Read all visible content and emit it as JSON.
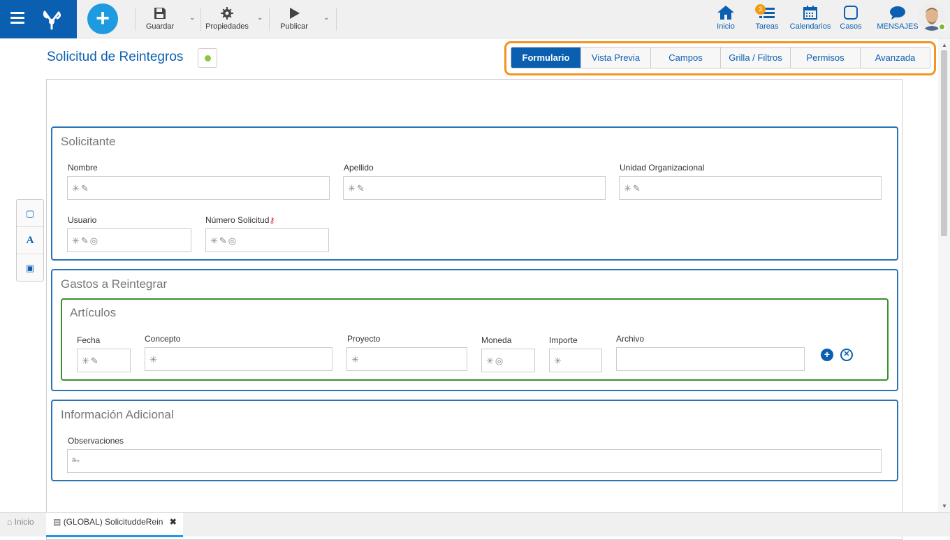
{
  "toolbar": {
    "save_label": "Guardar",
    "properties_label": "Propiedades",
    "publish_label": "Publicar"
  },
  "nav": {
    "home_label": "Inicio",
    "tasks_label": "Tareas",
    "tasks_badge": "3",
    "calendars_label": "Calendarios",
    "cases_label": "Casos",
    "messages_label": "MENSAJES"
  },
  "page": {
    "title": "Solicitud de Reintegros"
  },
  "tabs": [
    {
      "label": "Formulario",
      "active": true
    },
    {
      "label": "Vista Previa"
    },
    {
      "label": "Campos"
    },
    {
      "label": "Grilla / Filtros"
    },
    {
      "label": "Permisos"
    },
    {
      "label": "Avanzada"
    }
  ],
  "sections": {
    "solicitante": {
      "title": "Solicitante",
      "fields": {
        "nombre": "Nombre",
        "apellido": "Apellido",
        "unidad": "Unidad Organizacional",
        "usuario": "Usuario",
        "numero": "Número Solicitud"
      }
    },
    "gastos": {
      "title": "Gastos a Reintegrar",
      "articulos": {
        "title": "Artículos",
        "columns": {
          "fecha": "Fecha",
          "concepto": "Concepto",
          "proyecto": "Proyecto",
          "moneda": "Moneda",
          "importe": "Importe",
          "archivo": "Archivo"
        }
      }
    },
    "info": {
      "title": "Información Adicional",
      "fields": {
        "observaciones": "Observaciones"
      }
    }
  },
  "bottom": {
    "home_tab": "Inicio",
    "doc_tab": "(GLOBAL) SolicituddeRein"
  },
  "colors": {
    "brand": "#0b5fb0",
    "accent": "#1e9be0",
    "highlight": "#f39321",
    "section_border": "#2b73b6",
    "subsection_border": "#3a8f2d"
  }
}
